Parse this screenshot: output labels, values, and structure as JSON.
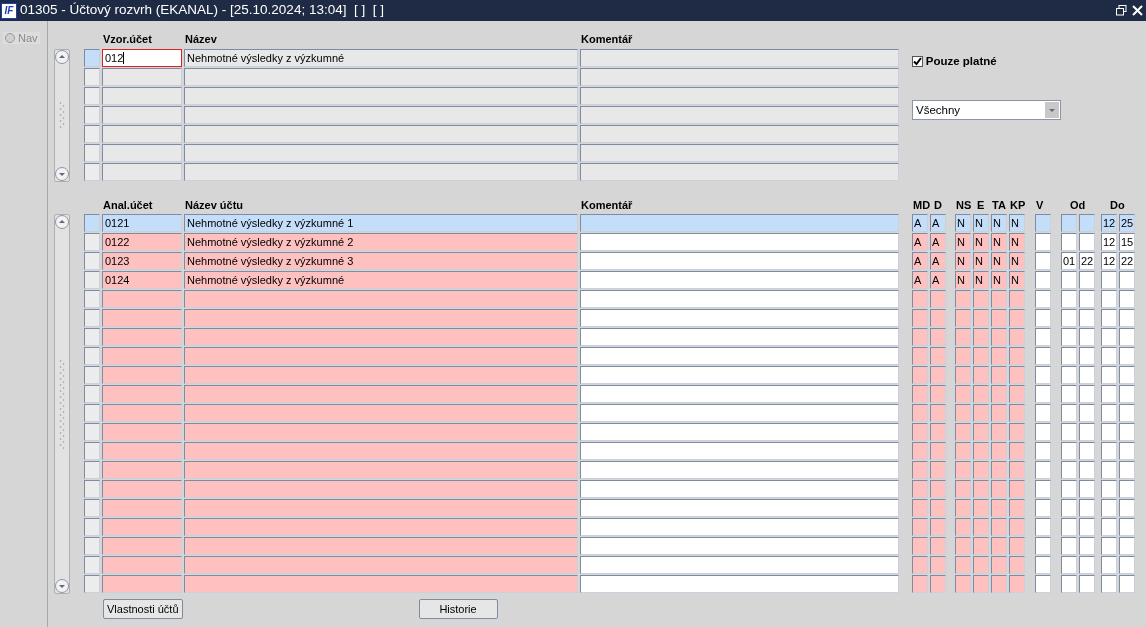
{
  "window": {
    "logo": "IF",
    "title": "01305 - Účtový rozvrh (EKANAL) - [25.10.2024; 13:04]  [ ]  [ ]"
  },
  "nav": {
    "label": "Nav",
    "selected": false
  },
  "template_accounts": {
    "columns": [
      "Vzor.účet",
      "Název",
      "Komentář"
    ],
    "rows": [
      {
        "account": "012",
        "name": "Nehmotné výsledky z výzkumné",
        "selected": true
      }
    ]
  },
  "filter": {
    "only_valid": {
      "label": "Pouze platné",
      "checked": true
    },
    "dropdown": {
      "value": "Všechny"
    }
  },
  "analytic_accounts": {
    "columns": [
      "Anal.účet",
      "Název účtu",
      "Komentář",
      "MD",
      "D",
      "NS",
      "E",
      "TA",
      "KP",
      "V",
      "Od",
      "Do"
    ],
    "rows": [
      {
        "account": "0121",
        "name": "Nehmotné výsledky z výzkumné 1",
        "md": "A",
        "d": "A",
        "ns": "N",
        "e": "N",
        "ta": "N",
        "kp": "N",
        "do": [
          "12",
          "25"
        ],
        "selected": true
      },
      {
        "account": "0122",
        "name": "Nehmotné výsledky z výzkumné 2",
        "md": "A",
        "d": "A",
        "ns": "N",
        "e": "N",
        "ta": "N",
        "kp": "N",
        "do": [
          "12",
          "15"
        ],
        "selected": false
      },
      {
        "account": "0123",
        "name": "Nehmotné výsledky z výzkumné 3",
        "md": "A",
        "d": "A",
        "ns": "N",
        "e": "N",
        "ta": "N",
        "kp": "N",
        "od": [
          "01",
          "22"
        ],
        "do": [
          "12",
          "22"
        ],
        "selected": false
      },
      {
        "account": "0124",
        "name": "Nehmotné výsledky z výzkumné",
        "md": "A",
        "d": "A",
        "ns": "N",
        "e": "N",
        "ta": "N",
        "kp": "N",
        "selected": false
      }
    ]
  },
  "buttons": [
    "Vlastnosti účtů",
    "Historie"
  ]
}
